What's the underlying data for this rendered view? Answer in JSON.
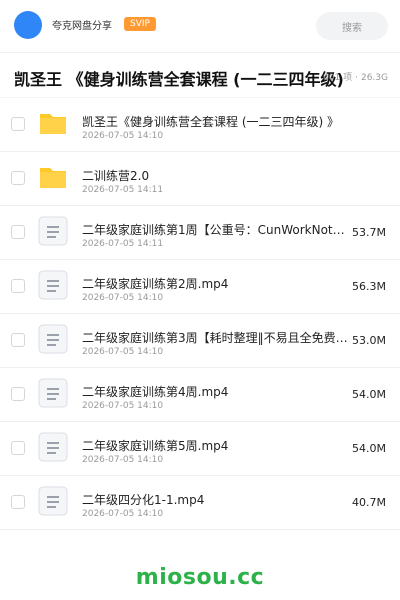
{
  "header": {
    "brand": "夸克网盘分享",
    "vip_badge": "SVIP",
    "search_placeholder": "搜索"
  },
  "title": "凯圣王 《健身训练营全套课程 (一二三四年级) 》",
  "meta": {
    "count": "401 项",
    "size": "26.3G"
  },
  "files": [
    {
      "type": "folder",
      "name": "凯圣王《健身训练营全套课程 (一二三四年级) 》",
      "date": "2026-07-05 14:10",
      "size": ""
    },
    {
      "type": "folder",
      "name": "二训练营2.0",
      "date": "2026-07-05 14:11",
      "size": ""
    },
    {
      "type": "file",
      "name": "二年级家庭训练第1周【公重号：CunWorkNot…",
      "date": "2026-07-05 14:11",
      "size": "53.7M"
    },
    {
      "type": "file",
      "name": "二年级家庭训练第2周.mp4",
      "date": "2026-07-05 14:10",
      "size": "56.3M"
    },
    {
      "type": "file",
      "name": "二年级家庭训练第3周【耗时整理‖不易且全免费：cu…",
      "date": "2026-07-05 14:10",
      "size": "53.0M"
    },
    {
      "type": "file",
      "name": "二年级家庭训练第4周.mp4",
      "date": "2026-07-05 14:10",
      "size": "54.0M"
    },
    {
      "type": "file",
      "name": "二年级家庭训练第5周.mp4",
      "date": "2026-07-05 14:10",
      "size": "54.0M"
    },
    {
      "type": "file",
      "name": "二年级四分化1-1.mp4",
      "date": "2026-07-05 14:10",
      "size": "40.7M"
    }
  ],
  "watermark": "miosou.cc",
  "colors": {
    "accent": "#2f86f7",
    "vip": "#ff9a32",
    "folder": "#ffc928",
    "watermark": "#2db24a"
  }
}
